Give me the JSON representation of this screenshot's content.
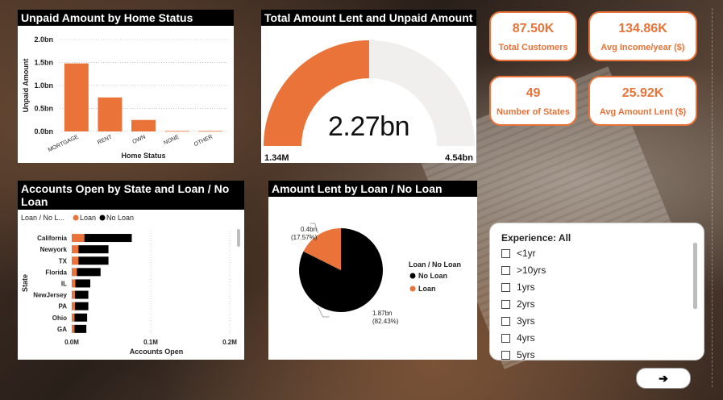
{
  "colors": {
    "accent": "#e97339",
    "dark": "#000000",
    "track": "#f0efee",
    "title_bg": "#000000",
    "title_text": "#ffffff"
  },
  "kpis": [
    {
      "value": "87.50K",
      "label": "Total Customers"
    },
    {
      "value": "134.86K",
      "label": "Avg Income/year ($)"
    },
    {
      "value": "49",
      "label": "Number of States"
    },
    {
      "value": "25.92K",
      "label": "Avg Amount Lent ($)"
    }
  ],
  "slicer": {
    "header": "Experience: All",
    "items": [
      "<1yr",
      ">10yrs",
      "1yrs",
      "2yrs",
      "3yrs",
      "4yrs",
      "5yrs"
    ]
  },
  "nav": {
    "arrow": "➔",
    "icon": "arrow-right-icon"
  },
  "chart_data": [
    {
      "type": "bar",
      "title": "Unpaid Amount by Home Status",
      "xlabel": "Home Status",
      "ylabel": "Unpaid Amount",
      "categories": [
        "MORTGAGE",
        "RENT",
        "OWN",
        "NONE",
        "OTHER"
      ],
      "values": [
        1.48,
        0.74,
        0.25,
        0.01,
        0.01
      ],
      "yticks": [
        "0.0bn",
        "0.5bn",
        "1.0bn",
        "1.5bn",
        "2.0bn"
      ],
      "ylim": [
        0,
        2.0
      ],
      "grid": true
    },
    {
      "type": "gauge",
      "title": "Total Amount Lent and Unpaid Amount",
      "value": 2.27,
      "value_label": "2.27bn",
      "min": 0.00134,
      "min_label": "1.34M",
      "max": 4.54,
      "max_label": "4.54bn"
    },
    {
      "type": "bar",
      "orientation": "horizontal",
      "stacked": true,
      "title": "Accounts Open by State and Loan / No Loan",
      "xlabel": "Accounts Open",
      "ylabel": "State",
      "legend_title": "Loan / No L...",
      "legend_position": "top-left",
      "categories": [
        "California",
        "Newyork",
        "TX",
        "Florida",
        "IL",
        "NewJersey",
        "PA",
        "Ohio",
        "GA"
      ],
      "series": [
        {
          "name": "Loan",
          "values": [
            0.016,
            0.0085,
            0.0085,
            0.0065,
            0.0045,
            0.004,
            0.004,
            0.0035,
            0.0035
          ]
        },
        {
          "name": "No Loan",
          "values": [
            0.06,
            0.038,
            0.038,
            0.03,
            0.019,
            0.017,
            0.017,
            0.016,
            0.015
          ]
        }
      ],
      "xticks": [
        "0.0M",
        "0.1M",
        "0.2M"
      ],
      "xlim": [
        0,
        0.2
      ],
      "grid": true
    },
    {
      "type": "pie",
      "title": "Amount Lent by Loan / No Loan",
      "legend_title": "Loan / No Loan",
      "legend_position": "right",
      "slices": [
        {
          "name": "No Loan",
          "value": 1.87,
          "label": "1.87bn",
          "pct": "(82.43%)"
        },
        {
          "name": "Loan",
          "value": 0.4,
          "label": "0.4bn",
          "pct": "(17.57%)"
        }
      ]
    }
  ]
}
